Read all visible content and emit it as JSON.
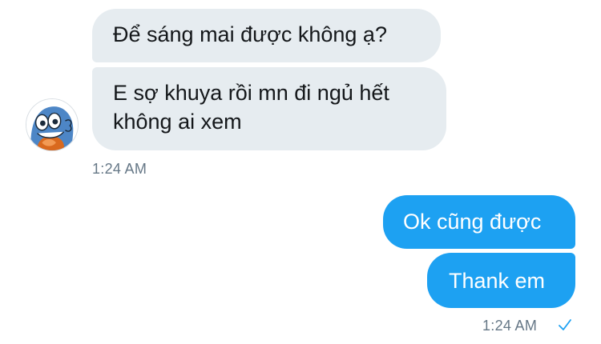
{
  "conversation": {
    "received": {
      "messages": [
        {
          "lines": [
            "Để sáng mai được không ạ?"
          ]
        },
        {
          "lines": [
            "E sợ khuya rồi mn đi ngủ hết",
            "không ai xem"
          ]
        }
      ],
      "timestamp": "1:24 AM",
      "avatar_icon": "cartoon-monster-avatar"
    },
    "sent": {
      "messages": [
        {
          "text": "Ok cũng được"
        },
        {
          "text": "Thank em"
        }
      ],
      "timestamp": "1:24 AM",
      "status_icon": "checkmark-icon"
    }
  },
  "colors": {
    "received_bubble": "#e6ecf0",
    "sent_bubble": "#1da1f2",
    "timestamp": "#657786",
    "read_check": "#1da1f2"
  }
}
